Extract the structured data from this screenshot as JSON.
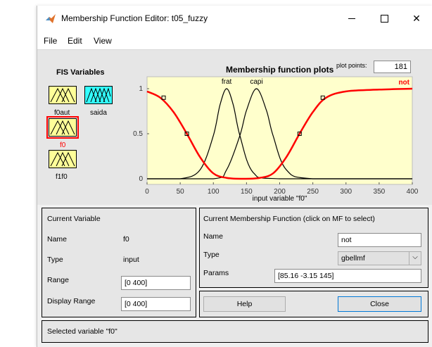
{
  "window": {
    "title": "Membership Function Editor: t05_fuzzy",
    "minimize_icon": "minimize-icon",
    "maximize_icon": "maximize-icon",
    "close_icon": "close-icon"
  },
  "menu": {
    "file": "File",
    "edit": "Edit",
    "view": "View"
  },
  "fis": {
    "title": "FIS Variables",
    "inputs": [
      {
        "label": "f0aut"
      },
      {
        "label": "f0",
        "selected": true
      },
      {
        "label": "f1f0"
      }
    ],
    "outputs": [
      {
        "label": "saida"
      }
    ]
  },
  "plot": {
    "title": "Membership function plots",
    "plot_points_label": "plot points:",
    "plot_points_value": "181"
  },
  "chart_data": {
    "type": "line",
    "xlabel": "input variable \"f0\"",
    "xlim": [
      0,
      400
    ],
    "ylim": [
      0,
      1
    ],
    "xticks": [
      "0",
      "50",
      "100",
      "150",
      "200",
      "250",
      "300",
      "350",
      "400"
    ],
    "yticks": [
      "0",
      "0.5",
      "1"
    ],
    "series": [
      {
        "name": "frat",
        "mf": "gaussmf",
        "color": "#000000",
        "x": [
          0,
          50,
          80,
          100,
          110,
          120,
          130,
          140,
          160,
          200,
          400
        ],
        "y": [
          0,
          0.0,
          0.1,
          0.48,
          0.82,
          1.0,
          0.82,
          0.48,
          0.07,
          0.0,
          0
        ]
      },
      {
        "name": "capi",
        "mf": "gaussmf",
        "color": "#000000",
        "x": [
          0,
          100,
          120,
          140,
          150,
          165,
          180,
          190,
          210,
          250,
          400
        ],
        "y": [
          0,
          0.0,
          0.1,
          0.48,
          0.76,
          1.0,
          0.76,
          0.48,
          0.1,
          0.0,
          0
        ]
      },
      {
        "name": "not",
        "mf": "gbellmf",
        "params": "[85.16 -3.15 145]",
        "color": "#ff0000",
        "selected": true,
        "x": [
          0,
          20,
          40,
          60,
          80,
          100,
          120,
          145,
          170,
          190,
          210,
          230,
          250,
          270,
          300,
          350,
          400
        ],
        "y": [
          0.97,
          0.9,
          0.74,
          0.5,
          0.24,
          0.06,
          0.01,
          0.0,
          0.01,
          0.06,
          0.24,
          0.5,
          0.74,
          0.9,
          0.97,
          0.99,
          1.0
        ]
      }
    ],
    "grid": false
  },
  "current_variable": {
    "header": "Current Variable",
    "name_label": "Name",
    "name_value": "f0",
    "type_label": "Type",
    "type_value": "input",
    "range_label": "Range",
    "range_value": "[0 400]",
    "display_range_label": "Display Range",
    "display_range_value": "[0 400]"
  },
  "current_mf": {
    "header": "Current Membership Function (click on MF to select)",
    "name_label": "Name",
    "name_value": "not",
    "type_label": "Type",
    "type_value": "gbellmf",
    "params_label": "Params",
    "params_value": "[85.16 -3.15 145]"
  },
  "buttons": {
    "help": "Help",
    "close": "Close"
  },
  "status": "Selected variable \"f0\"",
  "colors": {
    "plot_bg": "#ffffcc",
    "selected_mf": "#ff0000",
    "selection_outline": "#ff0000",
    "input_box": "#ffff99",
    "output_box": "#33ffff"
  }
}
